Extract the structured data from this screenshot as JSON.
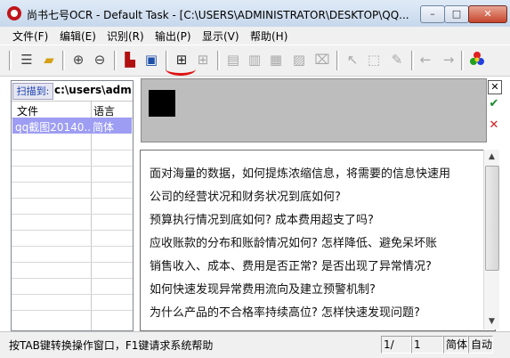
{
  "window": {
    "title": "尚书七号OCR - Default Task - [C:\\USERS\\ADMINISTRATOR\\DESKTOP\\QQ...",
    "minimize_glyph": "–",
    "maximize_glyph": "□",
    "close_glyph": "✕"
  },
  "menu": {
    "file": "文件(F)",
    "edit": "编辑(E)",
    "recognize": "识别(R)",
    "output": "输出(P)",
    "view": "显示(V)",
    "help": "帮助(H)"
  },
  "left_panel": {
    "scan_label": "扫描到:",
    "scan_path": "c:\\users\\admi",
    "columns": [
      "文件",
      "语言"
    ],
    "rows": [
      {
        "file": "qq截图20140...",
        "lang": "简体"
      }
    ]
  },
  "text_lines": [
    "面对海量的数据，如何提炼浓缩信息，将需要的信息快速用",
    "公司的经营状况和财务状况到底如何?",
    "预算执行情况到底如何? 成本费用超支了吗?",
    "应收账款的分布和账龄情况如何? 怎样降低、避免呆坏账",
    "销售收入、成本、费用是否正常? 是否出现了异常情况?",
    "如何快速发现异常费用流向及建立预警机制?",
    "为什么产品的不合格率持续高位? 怎样快速发现问题?"
  ],
  "statusbar": {
    "hint": "按TAB键转换操作窗口，F1键请求系统帮助",
    "page_current": "1/",
    "page_total": "1",
    "language": "简体",
    "mode": "自动"
  },
  "colors": {
    "selected_row": "#9d9df3",
    "scan_label_text": "#1a3fb0",
    "annotation_red": "#e01010",
    "image_panel_bg": "#bdbdbd"
  },
  "icons": [
    "text-toolbar-icon",
    "open-folder-icon",
    "zoom-in-icon",
    "zoom-out-icon",
    "scan-icon",
    "image-icon",
    "recognize-layout-icon",
    "recognize-disabled-icon",
    "vertical-text-icon",
    "table-icon",
    "grid-icon",
    "clear-icon",
    "select-icon",
    "edit-region-icon",
    "pick-icon",
    "pen-icon",
    "back-arrow-icon",
    "forward-arrow-icon",
    "colors-icon"
  ]
}
